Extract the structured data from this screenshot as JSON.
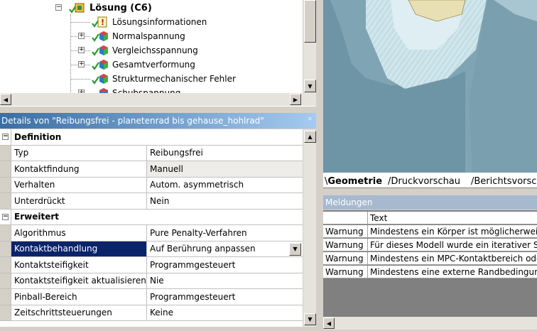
{
  "tree": {
    "nodes": [
      {
        "label": "Lösung (C6)",
        "bold": true,
        "expander": "−"
      },
      {
        "label": "Lösungsinformationen",
        "bold": false,
        "expander": ""
      },
      {
        "label": "Normalspannung",
        "bold": false,
        "expander": "+"
      },
      {
        "label": "Vergleichsspannung",
        "bold": false,
        "expander": "+"
      },
      {
        "label": "Gesamtverformung",
        "bold": false,
        "expander": "+"
      },
      {
        "label": "Strukturmechanischer Fehler",
        "bold": false,
        "expander": ""
      },
      {
        "label": "Schubspannung",
        "bold": false,
        "expander": "+"
      }
    ]
  },
  "details": {
    "header": "Details von \"Reibungsfrei - planetenrad bis gehause_hohlrad\"",
    "pin_icon": "pin-icon",
    "sections": [
      {
        "title": "Definition",
        "rows": [
          {
            "key": "Typ",
            "value": "Reibungsfrei"
          },
          {
            "key": "Kontaktfindung",
            "value": "Manuell"
          },
          {
            "key": "Verhalten",
            "value": "Autom. asymmetrisch"
          },
          {
            "key": "Unterdrückt",
            "value": "Nein"
          }
        ]
      },
      {
        "title": "Erweitert",
        "rows": [
          {
            "key": "Algorithmus",
            "value": "Pure Penalty-Verfahren"
          },
          {
            "key": "Kontaktbehandlung",
            "value": "Auf Berührung anpassen"
          },
          {
            "key": "Kontaktsteifigkeit",
            "value": "Programmgesteuert"
          },
          {
            "key": "Kontaktsteifigkeit aktualisieren",
            "value": "Nie"
          },
          {
            "key": "Pinball-Bereich",
            "value": "Programmgesteuert"
          },
          {
            "key": "Zeitschrittsteuerungen",
            "value": "Keine"
          }
        ]
      }
    ]
  },
  "tabs": [
    {
      "label": "Geometrie",
      "active": true
    },
    {
      "label": "Druckvorschau",
      "active": false
    },
    {
      "label": "Berichtsvorschau",
      "active": false
    }
  ],
  "messages": {
    "title": "Meldungen",
    "col_text": "Text",
    "rows": [
      {
        "type": "Warnung",
        "text": "Mindestens ein Körper ist möglicherweise"
      },
      {
        "type": "Warnung",
        "text": "Für dieses Modell wurde ein iterativer S"
      },
      {
        "type": "Warnung",
        "text": "Mindestens ein MPC-Kontaktbereich ode"
      },
      {
        "type": "Warnung",
        "text": "Mindestens eine externe Randbedingung"
      }
    ]
  },
  "colors": {
    "selection": "#0a246a",
    "header_gradient_start": "#3a6ea5",
    "viewport_bg": "#7fa4b4",
    "messages_header": "#a6b9cf"
  }
}
